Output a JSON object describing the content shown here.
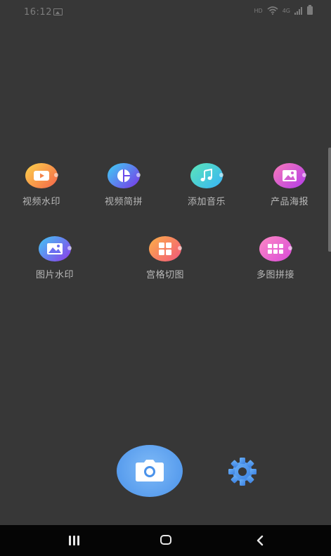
{
  "status_bar": {
    "time": "16:12",
    "network_label": "HD",
    "signal_label": "4G"
  },
  "tools_row1": [
    {
      "label": "视频水印",
      "icon": "video-icon",
      "color_start": "#fcd34b",
      "color_end": "#f4634a"
    },
    {
      "label": "视频简拼",
      "icon": "pie-chart-icon",
      "color_start": "#3ed1f4",
      "color_end": "#7a33e7"
    },
    {
      "label": "添加音乐",
      "icon": "music-note-icon",
      "color_start": "#5ce6b8",
      "color_end": "#37b3f7"
    },
    {
      "label": "产品海报",
      "icon": "image-icon",
      "color_start": "#f97ab9",
      "color_end": "#b23ce9"
    }
  ],
  "tools_row2": [
    {
      "label": "图片水印",
      "icon": "landscape-icon",
      "color_start": "#41c8f4",
      "color_end": "#8e38e9"
    },
    {
      "label": "宫格切图",
      "icon": "grid-four-icon",
      "color_start": "#fcb047",
      "color_end": "#f2567c"
    },
    {
      "label": "多图拼接",
      "icon": "grid-six-icon",
      "color_start": "#fd89c4",
      "color_end": "#d94ad9"
    }
  ],
  "bottom": {
    "camera_icon": "camera-icon",
    "settings_icon": "gear-icon",
    "accent": "#4a92ea"
  },
  "nav_bar": {
    "recent_icon": "recent-apps-icon",
    "home_icon": "home-icon",
    "back_icon": "back-icon"
  }
}
